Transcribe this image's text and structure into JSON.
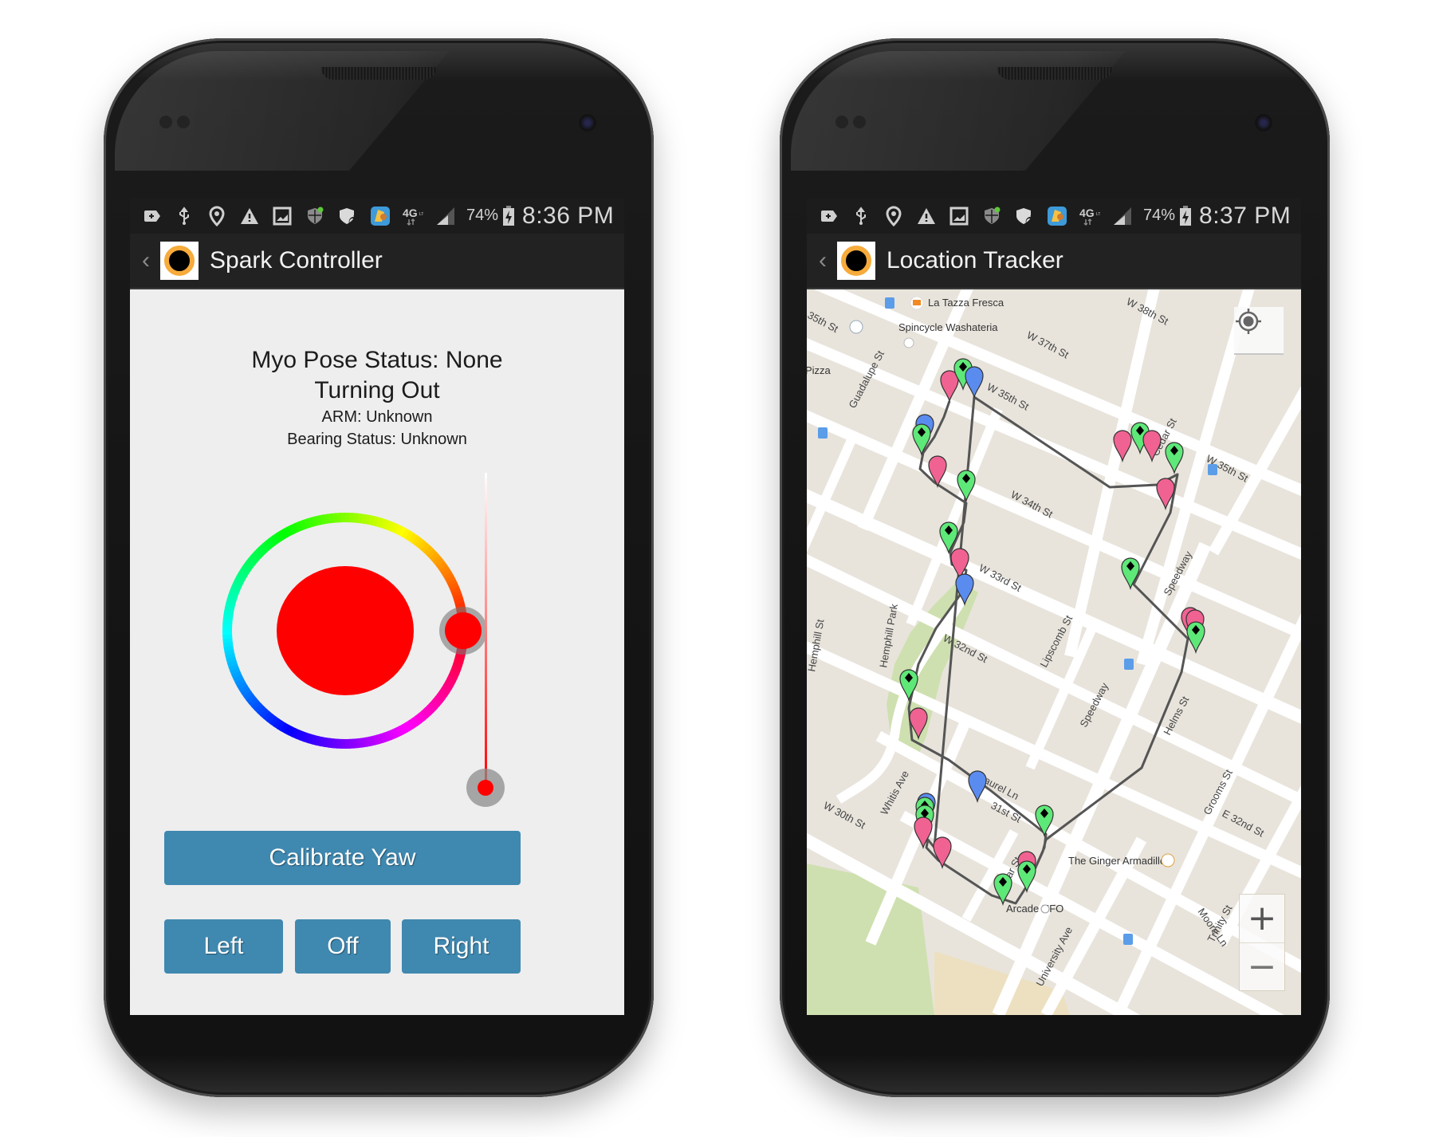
{
  "phones": {
    "left": {
      "status_bar": {
        "icons": [
          "add-label-icon",
          "usb-icon",
          "location-pin-icon",
          "warning-icon",
          "image-icon",
          "shield-notification-icon",
          "shield-sync-icon",
          "trophy-app-icon",
          "4g-lte-icon",
          "signal-icon"
        ],
        "battery": "74%",
        "battery_icon": "battery-charging-icon",
        "time": "8:36 PM"
      },
      "action_bar": {
        "back_icon": "‹",
        "title": "Spark Controller"
      },
      "status": {
        "pose": "Myo Pose Status: None",
        "turning": "Turning Out",
        "arm": "ARM: Unknown",
        "bearing": "Bearing Status: Unknown"
      },
      "color_picker": {
        "selected_color": "#ff0000",
        "hue_degrees": 0,
        "saturation_percent": 100
      },
      "buttons": {
        "calibrate": "Calibrate Yaw",
        "left": "Left",
        "off": "Off",
        "right": "Right"
      },
      "colors": {
        "button": "#3f88b0",
        "action_bar": "#222222",
        "status_bar": "#1c1c1c",
        "background": "#eeeeee"
      }
    },
    "right": {
      "status_bar": {
        "icons": [
          "add-label-icon",
          "usb-icon",
          "location-pin-icon",
          "warning-icon",
          "image-icon",
          "shield-notification-icon",
          "shield-sync-icon",
          "trophy-app-icon",
          "4g-lte-icon",
          "signal-icon"
        ],
        "battery": "74%",
        "battery_icon": "battery-charging-icon",
        "time": "8:37 PM"
      },
      "action_bar": {
        "back_icon": "‹",
        "title": "Location Tracker"
      },
      "map": {
        "street_labels": [
          "W 38th St",
          "W 37th St",
          "W 35th St",
          "W 35th St",
          "W 34th St",
          "W 33rd St",
          "W 32nd St",
          "31st St",
          "W 30th St",
          "Guadalupe St",
          "Cedar St",
          "Cedar St",
          "Lipscomb St",
          "Hemphill Park",
          "Speedway",
          "Speedway",
          "Helms St",
          "Grooms St",
          "E 32nd St",
          "University Ave",
          "Whitis Ave",
          "Laurel Ln",
          "35th St",
          "Hemphill St",
          "Moore Ln",
          "Trinity St"
        ],
        "poi_labels": [
          "La Tazza Fresca",
          "Spincycle Washateria",
          "Pizza",
          "The Ginger Armadillo",
          "Arcade UFO"
        ],
        "markers": [
          {
            "color": "pink"
          },
          {
            "color": "green"
          },
          {
            "color": "blue"
          },
          {
            "color": "blue"
          },
          {
            "color": "green"
          },
          {
            "color": "pink"
          },
          {
            "color": "green"
          },
          {
            "color": "green"
          },
          {
            "color": "pink"
          },
          {
            "color": "blue"
          },
          {
            "color": "green"
          },
          {
            "color": "pink"
          },
          {
            "color": "blue"
          },
          {
            "color": "blue"
          },
          {
            "color": "green"
          },
          {
            "color": "green"
          },
          {
            "color": "pink"
          },
          {
            "color": "pink"
          },
          {
            "color": "green"
          },
          {
            "color": "pink"
          },
          {
            "color": "green"
          },
          {
            "color": "green"
          },
          {
            "color": "pink"
          },
          {
            "color": "green"
          },
          {
            "color": "pink"
          },
          {
            "color": "green"
          },
          {
            "color": "pink"
          },
          {
            "color": "green"
          },
          {
            "color": "pink"
          },
          {
            "color": "pink"
          },
          {
            "color": "green"
          }
        ],
        "marker_colors": {
          "pink": "#f06292",
          "green": "#5ee878",
          "blue": "#5a8cf0"
        },
        "zoom_in_label": "+",
        "zoom_out_label": "−",
        "locate_icon": "my-location-icon"
      }
    }
  }
}
